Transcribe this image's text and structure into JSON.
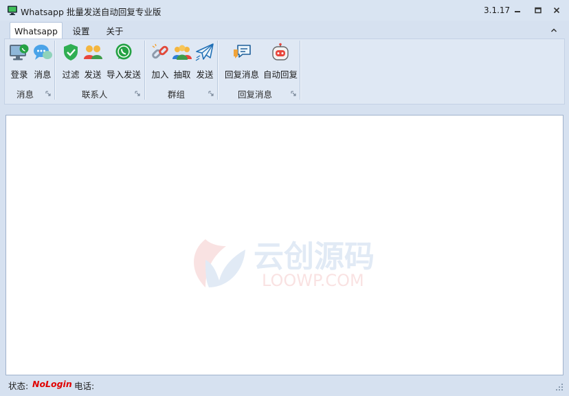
{
  "window": {
    "title": "Whatsapp 批量发送自动回复专业版",
    "version": "3.1.17",
    "app_icon": "monitor-icon",
    "controls": [
      "minimize-icon",
      "maximize-icon",
      "close-icon"
    ]
  },
  "tabs": [
    {
      "label": "Whatsapp",
      "active": true
    },
    {
      "label": "设置",
      "active": false
    },
    {
      "label": "关于",
      "active": false
    }
  ],
  "ribbon": {
    "groups": [
      {
        "label": "消息",
        "buttons": [
          {
            "label": "登录",
            "icon": "login-monitor-icon"
          },
          {
            "label": "消息",
            "icon": "chat-bubble-icon"
          }
        ]
      },
      {
        "label": "联系人",
        "buttons": [
          {
            "label": "过滤",
            "icon": "shield-check-icon"
          },
          {
            "label": "发送",
            "icon": "contacts-icon"
          },
          {
            "label": "导入发送",
            "icon": "whatsapp-phone-icon"
          }
        ]
      },
      {
        "label": "群组",
        "buttons": [
          {
            "label": "加入",
            "icon": "link-icon"
          },
          {
            "label": "抽取",
            "icon": "group-users-icon"
          },
          {
            "label": "发送",
            "icon": "paper-plane-icon"
          }
        ]
      },
      {
        "label": "回复消息",
        "buttons": [
          {
            "label": "回复消息",
            "icon": "reply-chat-icon"
          },
          {
            "label": "自动回复",
            "icon": "robot-icon"
          }
        ]
      }
    ]
  },
  "watermark": {
    "text_cn": "云创源码",
    "text_en": "LOOWP.COM"
  },
  "status": {
    "status_label": "状态:",
    "status_value": "NoLogin",
    "phone_label": "电话:",
    "phone_value": ""
  },
  "colors": {
    "window_bg": "#d6e1f0",
    "ribbon_bg": "#dfe8f4",
    "status_error": "#e00000",
    "whatsapp_green": "#25a244"
  }
}
